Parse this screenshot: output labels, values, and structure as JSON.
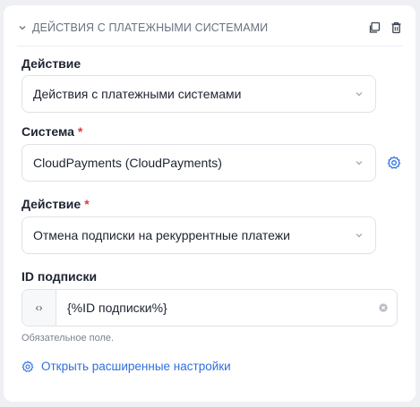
{
  "block": {
    "title": "ДЕЙСТВИЯ С ПЛАТЕЖНЫМИ СИСТЕМАМИ",
    "icons": {
      "collapse": "chevron-down-icon",
      "copy": "copy-icon",
      "delete": "trash-icon"
    }
  },
  "fields": {
    "action": {
      "label": "Действие",
      "value": "Действия с платежными системами"
    },
    "system": {
      "label": "Система",
      "required_mark": "*",
      "value": "CloudPayments (CloudPayments)",
      "settings_icon": "gear-icon"
    },
    "action2": {
      "label": "Действие",
      "required_mark": "*",
      "value": "Отмена подписки на рекуррентные платежи"
    },
    "subscription_id": {
      "label": "ID подписки",
      "prefix": "‹›",
      "value": "{%ID подписки%}",
      "hint": "Обязательное поле."
    }
  },
  "advanced_link": {
    "label": "Открыть расширенные настройки",
    "icon": "gear-icon"
  },
  "colors": {
    "accent": "#2f6fde",
    "required": "#e03a3a",
    "border": "#dfe2e7",
    "background": "#eef0f3"
  }
}
